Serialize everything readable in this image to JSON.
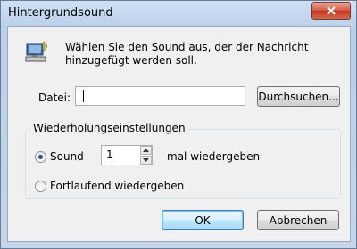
{
  "window": {
    "title": "Hintergrundsound"
  },
  "message": {
    "text": "Wählen Sie den Sound aus, der der Nachricht hinzugefügt werden soll."
  },
  "file": {
    "label": "Datei:",
    "value": "",
    "browse_label": "Durchsuchen..."
  },
  "repeat": {
    "legend": "Wiederholungseinstellungen",
    "sound_label": "Sound",
    "count_value": "1",
    "count_suffix": "mal wiedergeben",
    "loop_label": "Fortlaufend wiedergeben",
    "selected": "sound"
  },
  "buttons": {
    "ok_label": "OK",
    "cancel_label": "Abbrechen"
  },
  "icons": {
    "close": "close-icon",
    "message": "sound-computer-icon"
  },
  "colors": {
    "close_red": "#c2371f",
    "default_button_border": "#3c7fb1"
  }
}
